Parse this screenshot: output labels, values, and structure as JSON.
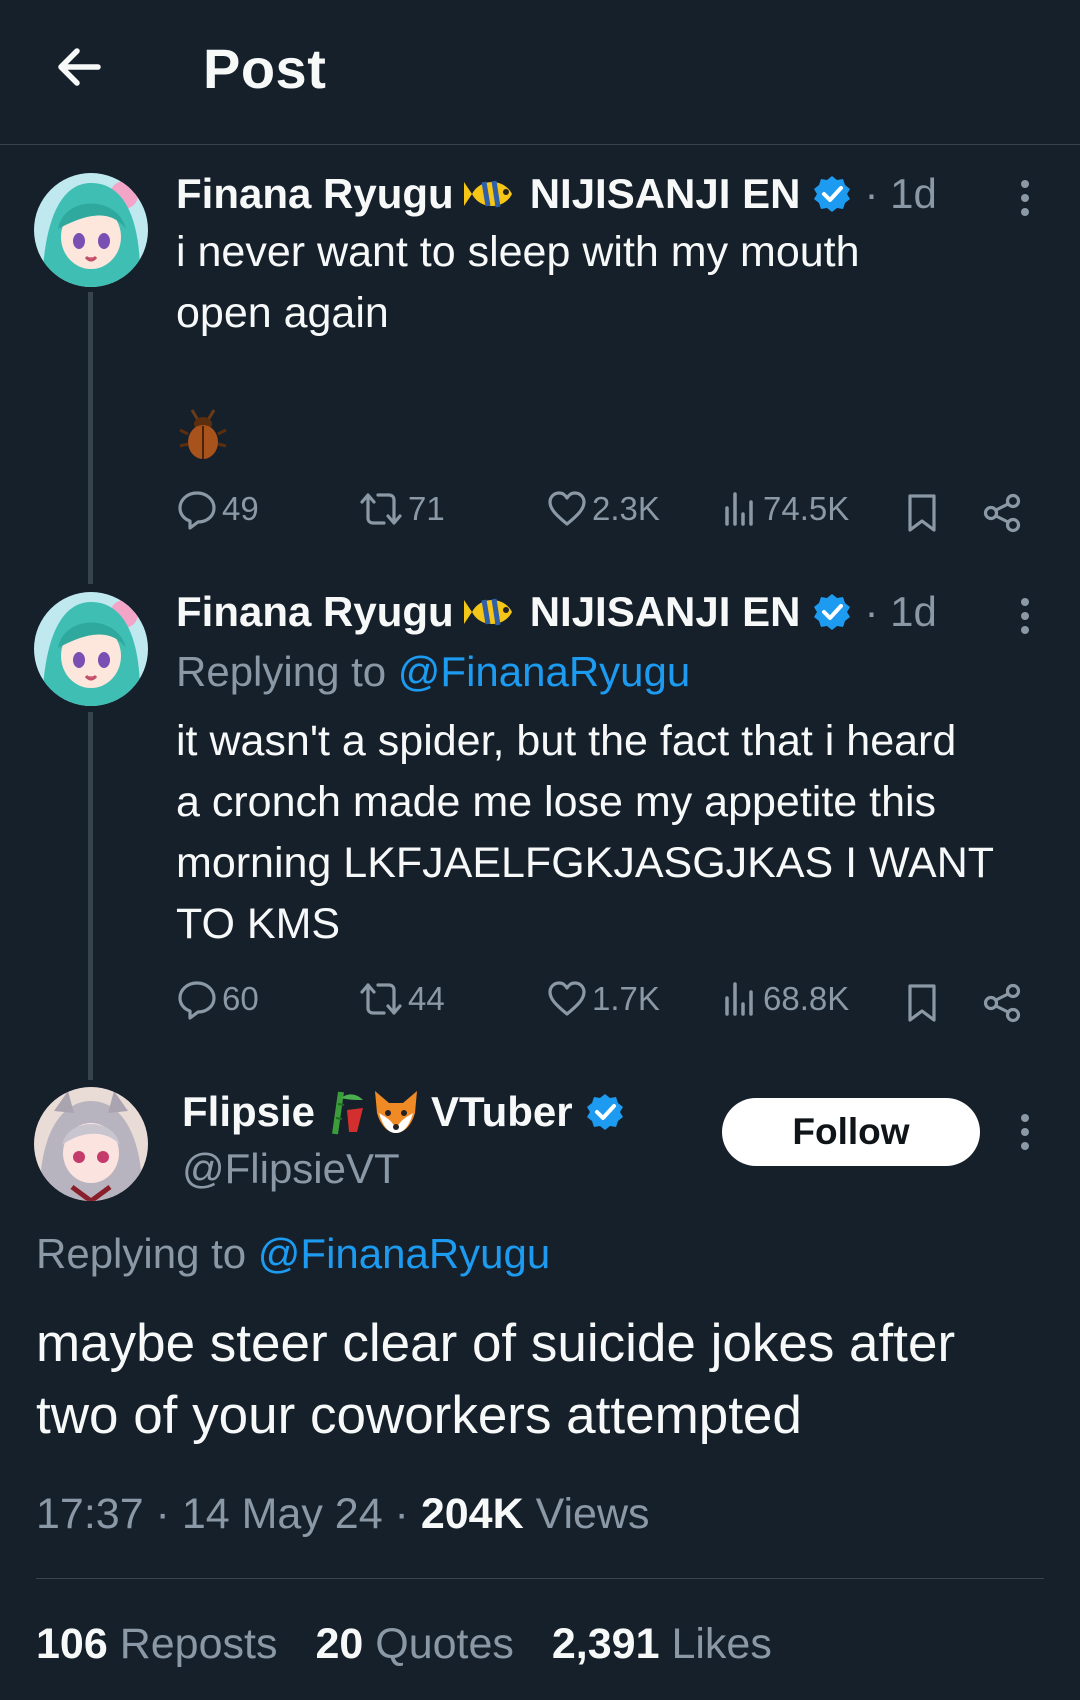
{
  "header": {
    "title": "Post"
  },
  "tweet1": {
    "name": "Finana Ryugu",
    "affiliation": "NIJISANJI EN",
    "time": "· 1d",
    "text_line1": "i never want to sleep with my mouth",
    "text_line2": "open again",
    "replies": "49",
    "reposts": "71",
    "likes": "2.3K",
    "views": "74.5K"
  },
  "tweet2": {
    "name": "Finana Ryugu",
    "affiliation": "NIJISANJI EN",
    "time": "· 1d",
    "replying_prefix": "Replying to ",
    "replying_handle": "@FinanaRyugu",
    "text_line1": "it wasn't a spider, but the fact that i heard",
    "text_line2": "a cronch made me lose my appetite this",
    "text_line3": "morning LKFJAELFGKJASGJKAS I WANT",
    "text_line4": "TO KMS",
    "replies": "60",
    "reposts": "44",
    "likes": "1.7K",
    "views": "68.8K"
  },
  "main_tweet": {
    "name": "Flipsie",
    "name_suffix": "VTuber",
    "handle": "@FlipsieVT",
    "follow_label": "Follow",
    "replying_prefix": "Replying to ",
    "replying_handle": "@FinanaRyugu",
    "text_line1": "maybe steer clear of suicide jokes after",
    "text_line2": "two of your coworkers attempted",
    "time": "17:37 · 14 May 24 · ",
    "views_count": "204K",
    "views_label": " Views",
    "reposts_count": "106",
    "reposts_label": " Reposts",
    "quotes_count": "20",
    "quotes_label": " Quotes",
    "likes_count": "2,391",
    "likes_label": " Likes"
  },
  "colors": {
    "background": "#15202b",
    "text": "#f7f9f9",
    "secondary": "#8b98a5",
    "accent": "#1d9bf0",
    "divider": "#38444d"
  },
  "icons": [
    "back-arrow-icon",
    "tropical-fish-emoji",
    "verified-badge-icon",
    "more-icon",
    "beetle-emoji",
    "reply-icon",
    "repost-icon",
    "like-icon",
    "views-icon",
    "bookmark-icon",
    "share-icon",
    "bamboo-emoji",
    "fox-emoji"
  ]
}
